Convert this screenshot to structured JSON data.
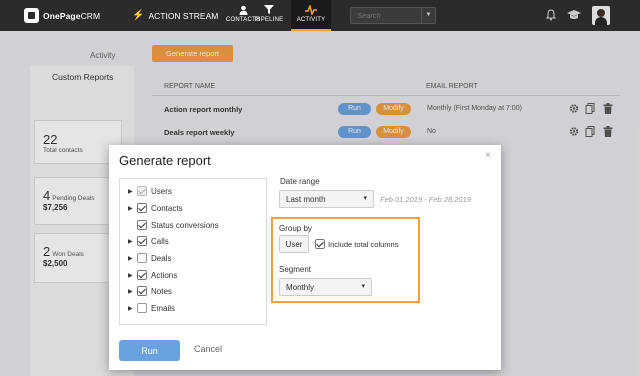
{
  "header": {
    "logo_bold": "OnePage",
    "logo_light": "CRM",
    "action_stream": "ACTION STREAM",
    "contacts": "CONTACTS",
    "pipeline": "PIPELINE",
    "activity": "ACTIVITY",
    "search_placeholder": "Search"
  },
  "sidebar": {
    "activity_tab": "Activity",
    "custom_reports_tab": "Custom Reports",
    "stats": [
      {
        "value": "22",
        "label": "Total contacts"
      },
      {
        "value": "4",
        "label": "Pending Deals",
        "amount": "$7,256"
      },
      {
        "value": "2",
        "label": "Won Deals",
        "amount": "$2,500"
      }
    ]
  },
  "main": {
    "generate_button": "Generate report",
    "col_report_name": "REPORT NAME",
    "col_email_report": "EMAIL REPORT",
    "rows": [
      {
        "name": "Action report monthly",
        "run": "Run",
        "modify": "Modify",
        "email": "Monthly (First Monday at 7:00)"
      },
      {
        "name": "Deals report weekly",
        "run": "Run",
        "modify": "Modify",
        "email": "No"
      }
    ]
  },
  "modal": {
    "title": "Generate report",
    "close": "×",
    "tree": [
      {
        "label": "Users",
        "checked": true
      },
      {
        "label": "Contacts",
        "checked": true
      },
      {
        "label": "Status conversions",
        "checked": true
      },
      {
        "label": "Calls",
        "checked": true
      },
      {
        "label": "Deals",
        "checked": false
      },
      {
        "label": "Actions",
        "checked": true
      },
      {
        "label": "Notes",
        "checked": true
      },
      {
        "label": "Emails",
        "checked": false
      }
    ],
    "date_range_label": "Date range",
    "date_range_value": "Last month",
    "date_range_text": "Feb 01,2019 - Feb 28,2019",
    "group_by_label": "Group by",
    "group_by_value": "User",
    "include_total": "Include total columns",
    "segment_label": "Segment",
    "segment_value": "Monthly",
    "run_button": "Run",
    "cancel_button": "Cancel"
  },
  "colors": {
    "accent_orange": "#f0a040",
    "accent_blue": "#6aa1e0",
    "topbar": "#2b2b2b"
  }
}
